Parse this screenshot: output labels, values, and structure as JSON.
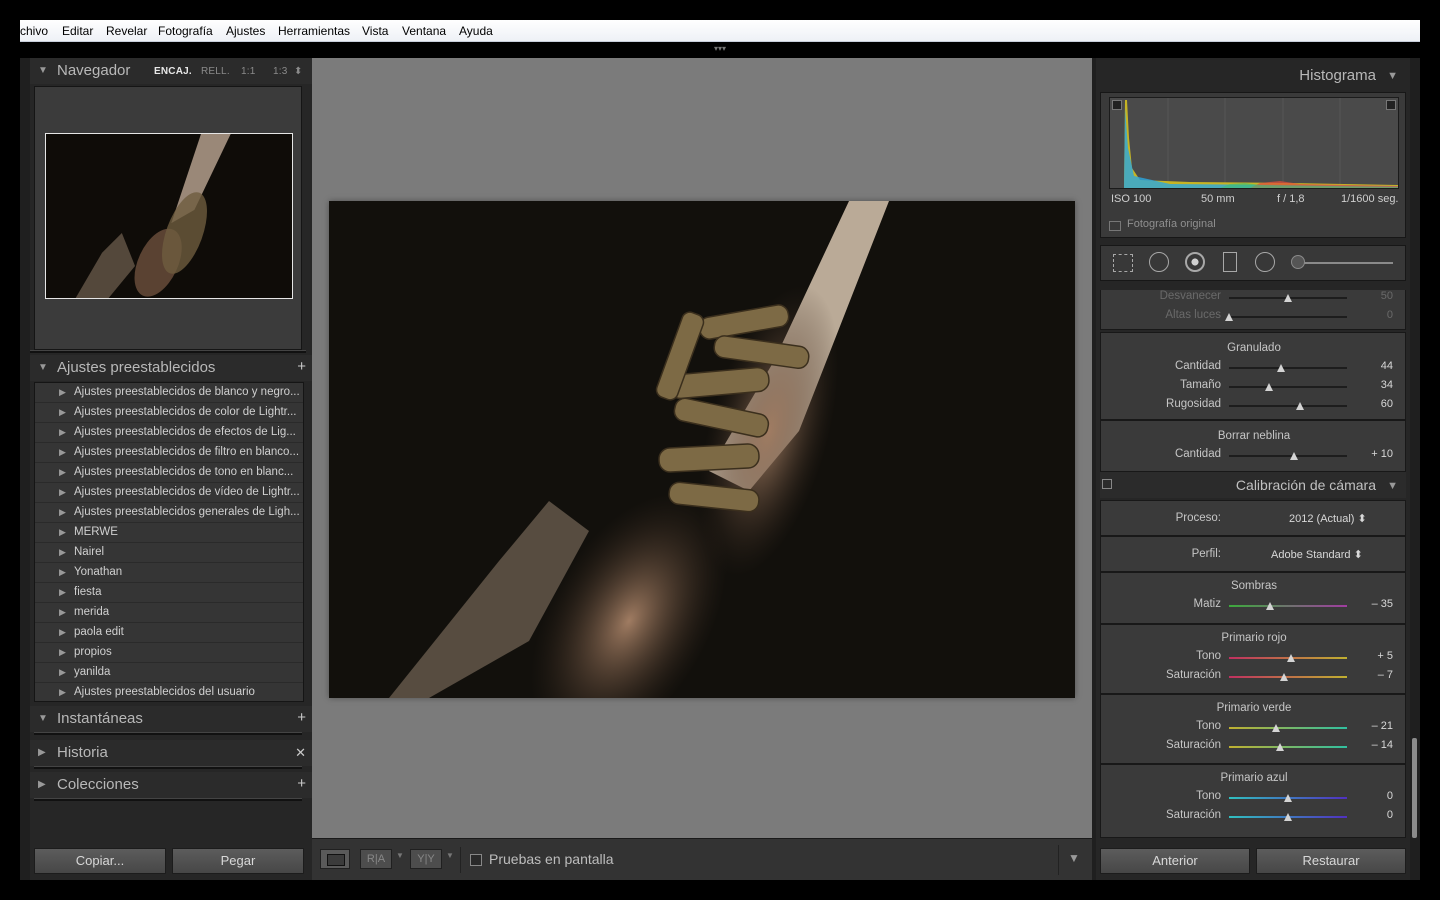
{
  "menu": [
    "chivo",
    "Editar",
    "Revelar",
    "Fotografía",
    "Ajustes",
    "Herramientas",
    "Vista",
    "Ventana",
    "Ayuda"
  ],
  "navigator": {
    "title": "Navegador",
    "zoom": [
      "ENCAJ.",
      "RELL.",
      "1:1",
      "1:3"
    ]
  },
  "presets": {
    "title": "Ajustes preestablecidos",
    "items": [
      "Ajustes preestablecidos de blanco y negro...",
      "Ajustes preestablecidos de color de Lightr...",
      "Ajustes preestablecidos de efectos de Lig...",
      "Ajustes preestablecidos de filtro en blanco...",
      "Ajustes preestablecidos de tono en blanc...",
      "Ajustes preestablecidos de vídeo de Lightr...",
      "Ajustes preestablecidos generales de Ligh...",
      "MERWE",
      "Nairel",
      "Yonathan",
      "fiesta",
      "merida",
      "paola edit",
      "propios",
      "yanilda",
      "Ajustes preestablecidos del usuario"
    ]
  },
  "panels": {
    "snapshots": "Instantáneas",
    "history": "Historia",
    "collections": "Colecciones"
  },
  "left_buttons": {
    "copy": "Copiar...",
    "paste": "Pegar"
  },
  "toolbar": {
    "proof": "Pruebas en pantalla",
    "ra": "R|A",
    "yy": "Y|Y"
  },
  "histogram": {
    "title": "Histograma",
    "iso": "ISO 100",
    "focal": "50 mm",
    "aperture": "f / 1,8",
    "shutter": "1/1600 seg.",
    "original": "Fotografía original"
  },
  "effects_top": {
    "sliders": [
      {
        "label": "Desvanecer",
        "value": "50",
        "pos": 0.5
      },
      {
        "label": "Altas luces",
        "value": "0",
        "pos": 0.0
      }
    ]
  },
  "grain": {
    "title": "Granulado",
    "sliders": [
      {
        "label": "Cantidad",
        "value": "44",
        "pos": 0.44
      },
      {
        "label": "Tamaño",
        "value": "34",
        "pos": 0.34
      },
      {
        "label": "Rugosidad",
        "value": "60",
        "pos": 0.6
      }
    ]
  },
  "dehaze": {
    "title": "Borrar neblina",
    "sliders": [
      {
        "label": "Cantidad",
        "value": "+ 10",
        "pos": 0.55
      }
    ]
  },
  "calibration": {
    "title": "Calibración de cámara",
    "process_label": "Proceso:",
    "process_value": "2012 (Actual) ⬍",
    "profile_label": "Perfil:",
    "profile_value": "Adobe Standard ⬍",
    "shadows": {
      "title": "Sombras",
      "sliders": [
        {
          "label": "Matiz",
          "value": "– 35",
          "pos": 0.35
        }
      ]
    },
    "red": {
      "title": "Primario rojo",
      "sliders": [
        {
          "label": "Tono",
          "value": "+ 5",
          "pos": 0.525
        },
        {
          "label": "Saturación",
          "value": "– 7",
          "pos": 0.465
        }
      ]
    },
    "green": {
      "title": "Primario verde",
      "sliders": [
        {
          "label": "Tono",
          "value": "– 21",
          "pos": 0.395
        },
        {
          "label": "Saturación",
          "value": "– 14",
          "pos": 0.43
        }
      ]
    },
    "blue": {
      "title": "Primario azul",
      "sliders": [
        {
          "label": "Tono",
          "value": "0",
          "pos": 0.5
        },
        {
          "label": "Saturación",
          "value": "0",
          "pos": 0.5
        }
      ]
    }
  },
  "right_buttons": {
    "previous": "Anterior",
    "reset": "Restaurar"
  }
}
